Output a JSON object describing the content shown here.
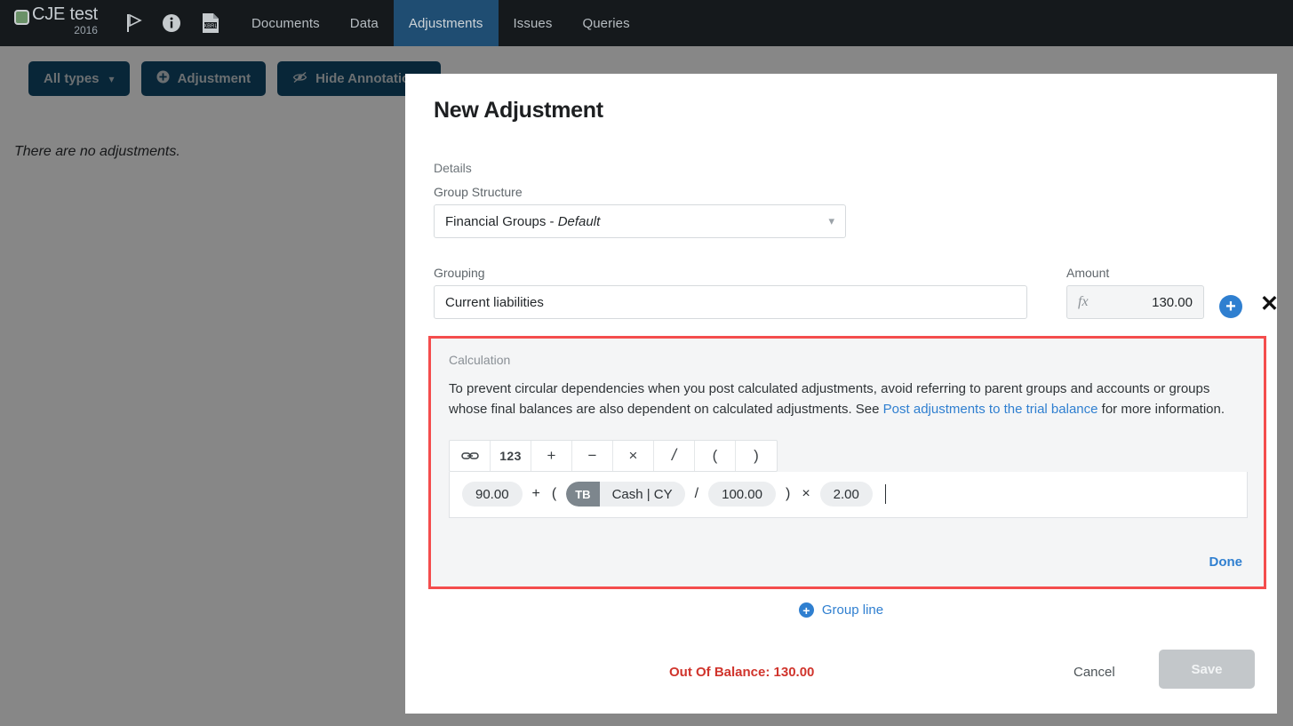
{
  "topnav": {
    "brand_name": "CJE test",
    "brand_year": "2016",
    "icons": [
      {
        "name": "flag-icon"
      },
      {
        "name": "info-icon"
      },
      {
        "name": "xbrl-document-icon",
        "label": "XBRL"
      }
    ],
    "tabs": [
      {
        "label": "Documents",
        "active": false
      },
      {
        "label": "Data",
        "active": false
      },
      {
        "label": "Adjustments",
        "active": true
      },
      {
        "label": "Issues",
        "active": false
      },
      {
        "label": "Queries",
        "active": false
      }
    ],
    "active_tab_color": "#1f4d72"
  },
  "toolbar": {
    "all_types_label": "All types",
    "adjustment_label": "Adjustment",
    "hide_annotations_label": "Hide Annotations",
    "button_color": "#10496b"
  },
  "page": {
    "empty_message": "There are no adjustments."
  },
  "modal": {
    "title": "New Adjustment",
    "details_label": "Details",
    "group_structure": {
      "label": "Group Structure",
      "value_main": "Financial Groups - ",
      "value_emphasis": "Default"
    },
    "grouping": {
      "label": "Grouping",
      "value": "Current liabilities"
    },
    "amount": {
      "label": "Amount",
      "value": "130.00",
      "fx_icon": "fx"
    },
    "add_line_icon": "plus-circle-icon",
    "remove_line_icon": "close-x-icon",
    "calculation": {
      "label": "Calculation",
      "help_text_before": "To prevent circular dependencies when you post calculated adjustments, avoid referring to parent groups and accounts or groups whose final balances are also dependent on calculated adjustments. See ",
      "help_link": "Post adjustments to the trial balance",
      "help_text_after": " for more information.",
      "toolbar_buttons": [
        {
          "name": "link-icon",
          "label": "⊖"
        },
        {
          "name": "number-button",
          "label": "123"
        },
        {
          "name": "plus-button",
          "label": "+"
        },
        {
          "name": "minus-button",
          "label": "−"
        },
        {
          "name": "multiply-button",
          "label": "×"
        },
        {
          "name": "divide-button",
          "label": "/"
        },
        {
          "name": "open-paren-button",
          "label": "("
        },
        {
          "name": "close-paren-button",
          "label": ")"
        }
      ],
      "formula_tokens": [
        {
          "type": "pill",
          "text": "90.00"
        },
        {
          "type": "op",
          "text": "+"
        },
        {
          "type": "op",
          "text": "("
        },
        {
          "type": "ref",
          "tag": "TB",
          "text": "Cash | CY"
        },
        {
          "type": "op",
          "text": "/"
        },
        {
          "type": "pill",
          "text": "100.00"
        },
        {
          "type": "op",
          "text": ")"
        },
        {
          "type": "op",
          "text": "×"
        },
        {
          "type": "pill",
          "text": "2.00"
        }
      ],
      "done_label": "Done",
      "highlight_color": "#f44d4d"
    },
    "group_line_label": "Group line",
    "footer": {
      "out_of_balance": "Out Of Balance: 130.00",
      "out_of_balance_color": "#d0342c",
      "cancel_label": "Cancel",
      "save_label": "Save"
    }
  }
}
